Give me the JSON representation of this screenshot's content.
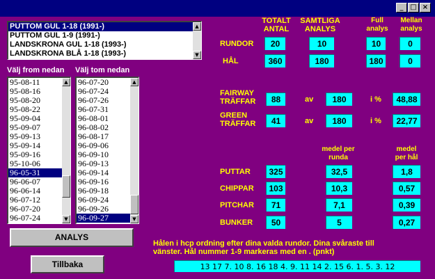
{
  "window": {
    "minimize": "_",
    "maximize": "□",
    "close": "×"
  },
  "courses": {
    "items": [
      "PUTTOM GUL 1-18 (1991-)",
      "PUTTOM GUL 1-9 (1991-)",
      "LANDSKRONA GUL 1-18 (1993-)",
      "LANDSKRONA BLÅ 1-18 (1993-)"
    ],
    "selected_index": 0
  },
  "from": {
    "label": "Välj from nedan",
    "items": [
      "95-08-11",
      "95-08-16",
      "95-08-20",
      "95-08-22",
      "95-09-04",
      "95-09-07",
      "95-09-13",
      "95-09-14",
      "95-09-16",
      "95-10-06",
      "96-05-31",
      "96-06-07",
      "96-06-14",
      "96-07-12",
      "96-07-20",
      "96-07-24"
    ],
    "selected_index": 10
  },
  "to": {
    "label": "Välj tom nedan",
    "items": [
      "96-07-20",
      "96-07-24",
      "96-07-26",
      "96-07-31",
      "96-08-01",
      "96-08-02",
      "96-08-17",
      "96-09-06",
      "96-09-10",
      "96-09-13",
      "96-09-14",
      "96-09-16",
      "96-09-18",
      "96-09-24",
      "96-09-26",
      "96-09-27"
    ],
    "selected_index": 15
  },
  "headers": {
    "totalt_line1": "TOTALT",
    "totalt_line2": "ANTAL",
    "samtliga_line1": "SAMTLIGA",
    "samtliga_line2": "ANALYS",
    "full_line1": "Full",
    "full_line2": "analys",
    "mellan_line1": "Mellan",
    "mellan_line2": "analys"
  },
  "rundor": {
    "label": "RUNDOR",
    "total": "20",
    "samtliga": "10",
    "full": "10",
    "mellan": "0"
  },
  "hal": {
    "label": "HÅL",
    "total": "360",
    "samtliga": "180",
    "full": "180",
    "mellan": "0"
  },
  "fairway": {
    "label_line1": "FAIRWAY",
    "label_line2": "TRÄFFAR",
    "value": "88",
    "av": "av",
    "of": "180",
    "pct_label": "i %",
    "pct": "48,88"
  },
  "green": {
    "label_line1": "GREEN",
    "label_line2": "TRÄFFAR",
    "value": "41",
    "av": "av",
    "of": "180",
    "pct_label": "i %",
    "pct": "22,77"
  },
  "medel_headers": {
    "runda_line1": "medel per",
    "runda_line2": "runda",
    "hal_line1": "medel",
    "hal_line2": "per hål"
  },
  "stats": [
    {
      "label": "PUTTAR",
      "total": "325",
      "per_round": "32,5",
      "per_hole": "1,8"
    },
    {
      "label": "CHIPPAR",
      "total": "103",
      "per_round": "10,3",
      "per_hole": "0,57"
    },
    {
      "label": "PITCHAR",
      "total": "71",
      "per_round": "7,1",
      "per_hole": "0,39"
    },
    {
      "label": "BUNKER",
      "total": "50",
      "per_round": "5",
      "per_hole": "0,27"
    }
  ],
  "info_text_line1": "Hålen i hcp ordning efter dina valda rundor. Dina svåraste till",
  "info_text_line2": "vänster.  Hål nummer 1-9 markeras med en . (pnkt)",
  "hole_order": "13 17 7. 10 8. 16 18 4. 9. 11 14 2. 15 6. 1. 5. 3. 12",
  "buttons": {
    "analys": "ANALYS",
    "tillbaka": "Tillbaka"
  }
}
